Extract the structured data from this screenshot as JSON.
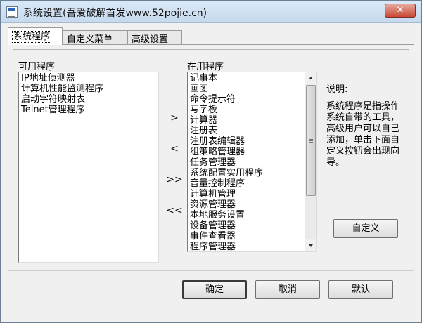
{
  "window": {
    "title": "系统设置(吾爱破解首发www.52pojie.cn)",
    "close_label": "✕"
  },
  "tabs": [
    {
      "label": "系统程序",
      "active": true
    },
    {
      "label": "自定义菜单",
      "active": false
    },
    {
      "label": "高级设置",
      "active": false
    }
  ],
  "available": {
    "label": "可用程序",
    "items": [
      "IP地址侦测器",
      "计算机性能监测程序",
      "启动字符映射表",
      "Telnet管理程序"
    ]
  },
  "in_use": {
    "label": "在用程序",
    "items": [
      "记事本",
      "画图",
      "命令提示符",
      "写字板",
      "计算器",
      "注册表",
      "注册表编辑器",
      "组策略管理器",
      "任务管理器",
      "系统配置实用程序",
      "音量控制程序",
      "计算机管理",
      "资源管理器",
      "本地服务设置",
      "设备管理器",
      "事件查看器",
      "程序管理器"
    ]
  },
  "move_buttons": {
    "add": ">",
    "remove": "<",
    "add_all": ">>",
    "remove_all": "<<"
  },
  "description": {
    "label": "说明:",
    "text": "系统程序是指操作系统自带的工具，高级用户可以自己添加，单击下面自定义按钮会出现向导。"
  },
  "custom_button": "自定义",
  "footer": {
    "ok": "确定",
    "cancel": "取消",
    "default": "默认"
  },
  "icons": {
    "app": "settings-window-icon",
    "close": "close-icon"
  }
}
